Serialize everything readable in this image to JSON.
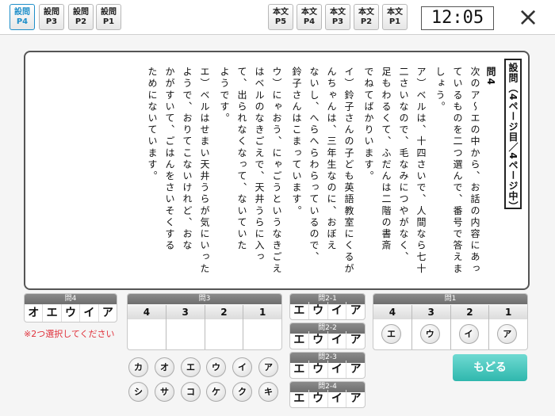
{
  "nav": {
    "question_tabs": [
      {
        "top": "設問",
        "bottom": "P4",
        "active": true
      },
      {
        "top": "設問",
        "bottom": "P3",
        "active": false
      },
      {
        "top": "設問",
        "bottom": "P2",
        "active": false
      },
      {
        "top": "設問",
        "bottom": "P1",
        "active": false
      }
    ],
    "text_tabs": [
      {
        "top": "本文",
        "bottom": "P5"
      },
      {
        "top": "本文",
        "bottom": "P4"
      },
      {
        "top": "本文",
        "bottom": "P3"
      },
      {
        "top": "本文",
        "bottom": "P2"
      },
      {
        "top": "本文",
        "bottom": "P1"
      }
    ],
    "clock": "12:05",
    "close_icon": "×"
  },
  "question": {
    "title_tab": "設問（4ページ目／4ページ中）",
    "number": "問4",
    "lines": [
      "次のア〜エの中から、お話の内容にあっ",
      "ているものを二つ選んで、番号で答えま",
      "しょう。",
      "ア）ベルは、十四さいで、人間なら七十",
      "二さいなので、毛なみにつやがなく、",
      "足もわるくて、ふだんは二階の書斎",
      "でねてばかりいます。",
      "イ）鈴子さんの子ども英語教室にくるが",
      "んちゃんは、三年生なのに、おぼえ",
      "ないし、へらへらわらっているので、",
      "鈴子さんはこまっています。",
      "ウ）にゃおう、にゃごうというなきごえ",
      "はベルのなきごえで、天井うらに入っ",
      "て、出られなくなって、ないていた",
      "ようです。",
      "エ）ベルはせまい天井うらが気にいった",
      "ようで、おりてこないけれど、おな",
      "かがすいて、ごはんをさいそくする",
      "ためにないています。"
    ]
  },
  "answers": {
    "q4": {
      "label": "問4",
      "options": [
        "オ",
        "エ",
        "ウ",
        "イ",
        "ア"
      ]
    },
    "q3": {
      "label": "問3",
      "columns": [
        "4",
        "3",
        "2",
        "1"
      ]
    },
    "q2_1": {
      "label": "問2-1",
      "options": [
        "エ",
        "ウ",
        "イ",
        "ア"
      ]
    },
    "q2_2": {
      "label": "問2-2",
      "options": [
        "エ",
        "ウ",
        "イ",
        "ア"
      ]
    },
    "q2_3": {
      "label": "問2-3",
      "options": [
        "エ",
        "ウ",
        "イ",
        "ア"
      ]
    },
    "q2_4": {
      "label": "問2-4",
      "options": [
        "エ",
        "ウ",
        "イ",
        "ア"
      ]
    },
    "q1": {
      "label": "問1",
      "columns": [
        "4",
        "3",
        "2",
        "1"
      ],
      "values": [
        "エ",
        "ウ",
        "イ",
        "ア"
      ]
    },
    "q3_choices_row1": [
      "カ",
      "オ",
      "エ",
      "ウ",
      "イ",
      "ア"
    ],
    "q3_choices_row2": [
      "シ",
      "サ",
      "コ",
      "ケ",
      "ク",
      "キ"
    ]
  },
  "warning": "※2つ選択してください",
  "back_button": "もどる",
  "colors": {
    "accent_blue": "#1f8fc9",
    "back_button": "#2fb7ad",
    "warning": "#e0303a"
  }
}
